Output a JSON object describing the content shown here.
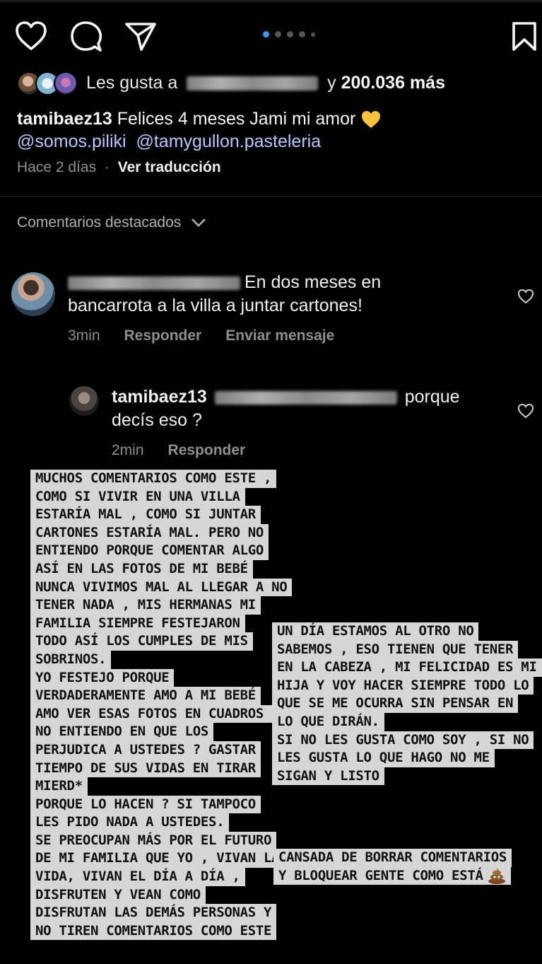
{
  "actions": {
    "like": "heart-icon",
    "comment": "comment-icon",
    "share": "share-icon",
    "save": "bookmark-icon"
  },
  "likes": {
    "prefix": "Les gusta a",
    "connector": "y",
    "count": "200.036 más"
  },
  "caption": {
    "username": "tamibaez13",
    "text": "Felices 4 meses Jami mi amor",
    "emoji": "yellow-heart",
    "mention1": "@somos.piliki",
    "mention2": "@tamygullon.pasteleria"
  },
  "meta": {
    "time": "Hace 2 días",
    "separator": "·",
    "translate": "Ver traducción"
  },
  "featured": {
    "label": "Comentarios destacados"
  },
  "comment1": {
    "text_line1": "En dos meses en",
    "text_line2": "bancarrota a la villa a juntar cartones!",
    "time": "3min",
    "reply": "Responder",
    "send": "Enviar mensaje"
  },
  "comment2": {
    "username": "tamibaez13",
    "text_tail": "porque",
    "text_line2": "decís eso ?",
    "time": "2min",
    "reply": "Responder"
  },
  "story_left": [
    "MUCHOS COMENTARIOS COMO ESTE ,",
    "COMO SI VIVIR EN UNA VILLA",
    "ESTARÍA MAL , COMO SI JUNTAR",
    "CARTONES ESTARÍA MAL. PERO NO",
    "ENTIENDO PORQUE COMENTAR ALGO",
    "ASÍ EN LAS FOTOS DE MI BEBÉ",
    "NUNCA VIVIMOS MAL AL LLEGAR A NO",
    "TENER NADA , MIS HERMANAS MI",
    "FAMILIA SIEMPRE FESTEJARON",
    "TODO ASÍ LOS CUMPLES DE MIS",
    "SOBRINOS.",
    "YO FESTEJO PORQUE",
    "VERDADERAMENTE AMO A MI BEBÉ",
    "AMO VER ESAS FOTOS EN CUADROS ,",
    "NO ENTIENDO EN QUE LOS",
    "PERJUDICA A USTEDES ? GASTAR",
    "TIEMPO DE SUS VIDAS EN TIRAR",
    "MIERD*",
    "PORQUE LO HACEN ? SI TAMPOCO",
    "LES PIDO NADA A USTEDES.",
    "SE PREOCUPAN MÁS POR EL FUTURO",
    "DE MI FAMILIA QUE YO , VIVAN LA",
    "VIDA, VIVAN EL DÍA A DÍA ,",
    "DISFRUTEN Y VEAN COMO",
    "DISFRUTAN LAS DEMÁS PERSONAS Y",
    "NO TIREN COMENTARIOS COMO ESTE"
  ],
  "story_right": [
    "UN DÍA ESTAMOS AL OTRO NO",
    "SABEMOS , ESO TIENEN QUE TENER",
    "EN LA CABEZA , MI FELICIDAD ES MI",
    "HIJA Y VOY HACER SIEMPRE TODO LO",
    "QUE SE ME OCURRA SIN PENSAR EN",
    "LO QUE DIRÁN.",
    "SI NO LES GUSTA COMO SOY , SI NO",
    "LES GUSTA LO QUE HAGO NO ME",
    "SIGAN Y LISTO"
  ],
  "story_bottom": [
    "CANSADA DE BORRAR COMENTARIOS",
    "Y BLOQUEAR GENTE COMO ESTÁ"
  ],
  "story_bottom_emoji": "poop-emoji"
}
